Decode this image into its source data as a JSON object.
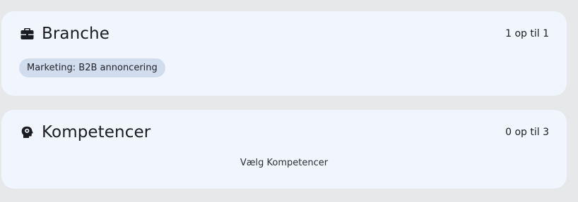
{
  "sections": {
    "branche": {
      "icon": "briefcase-icon",
      "title": "Branche",
      "count": "1 op til 1",
      "chips": [
        "Marketing: B2B annoncering"
      ]
    },
    "kompetencer": {
      "icon": "head-gear-icon",
      "title": "Kompetencer",
      "count": "0 op til 3",
      "select_label": "Vælg Kompetencer"
    }
  },
  "colors": {
    "page_background": "#e7e8ea",
    "card_background": "#f1f5fd",
    "chip_background": "#d1dced",
    "text": "#1b1c21"
  }
}
